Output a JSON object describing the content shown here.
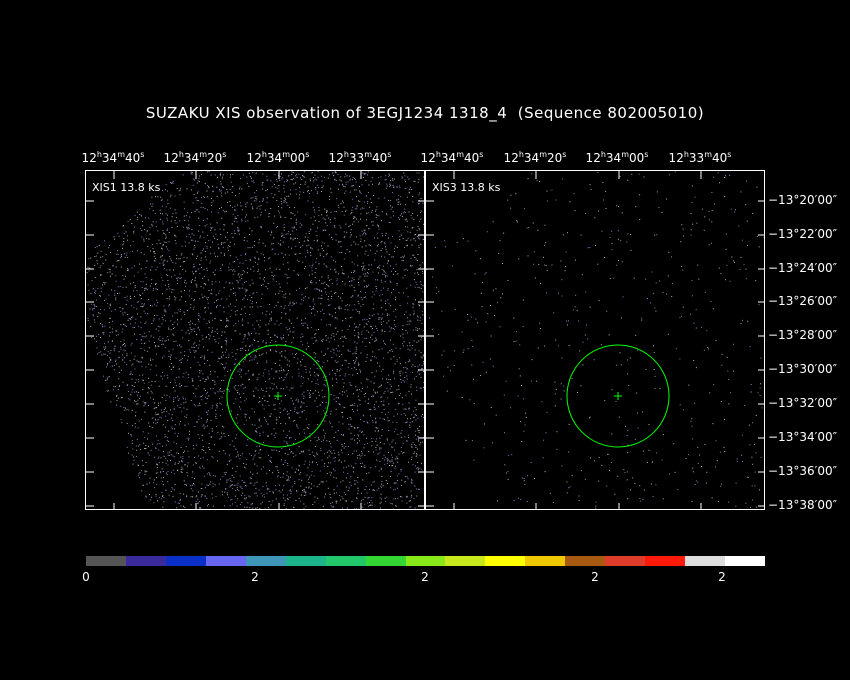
{
  "title": "SUZAKU XIS observation of 3EGJ1234 1318_4  (Sequence 802005010)",
  "ra_labels": [
    {
      "h": "12",
      "m": "34",
      "s": "40"
    },
    {
      "h": "12",
      "m": "34",
      "s": "20"
    },
    {
      "h": "12",
      "m": "34",
      "s": "00"
    },
    {
      "h": "12",
      "m": "33",
      "s": "40"
    }
  ],
  "dec_labels": [
    "−13°20′00″",
    "−13°22′00″",
    "−13°24′00″",
    "−13°26′00″",
    "−13°28′00″",
    "−13°30′00″",
    "−13°32′00″",
    "−13°34′00″",
    "−13°36′00″",
    "−13°38′00″"
  ],
  "panels": [
    {
      "label": "XIS1 13.8 ks",
      "density": 1.0
    },
    {
      "label": "XIS3 13.8 ks",
      "density": 0.12
    }
  ],
  "region_color": "#00ff00",
  "colorbar": {
    "colors": [
      "#555555",
      "#3b2a9b",
      "#0a2fc8",
      "#6666f0",
      "#3f96b8",
      "#1db48c",
      "#22c76a",
      "#33d633",
      "#88e81a",
      "#c7e81a",
      "#ffff00",
      "#f0c800",
      "#a85a10",
      "#e03c2c",
      "#ff1a0a",
      "#dddddd",
      "#ffffff"
    ],
    "labels": [
      "0",
      "2",
      "2",
      "2",
      "2"
    ]
  }
}
